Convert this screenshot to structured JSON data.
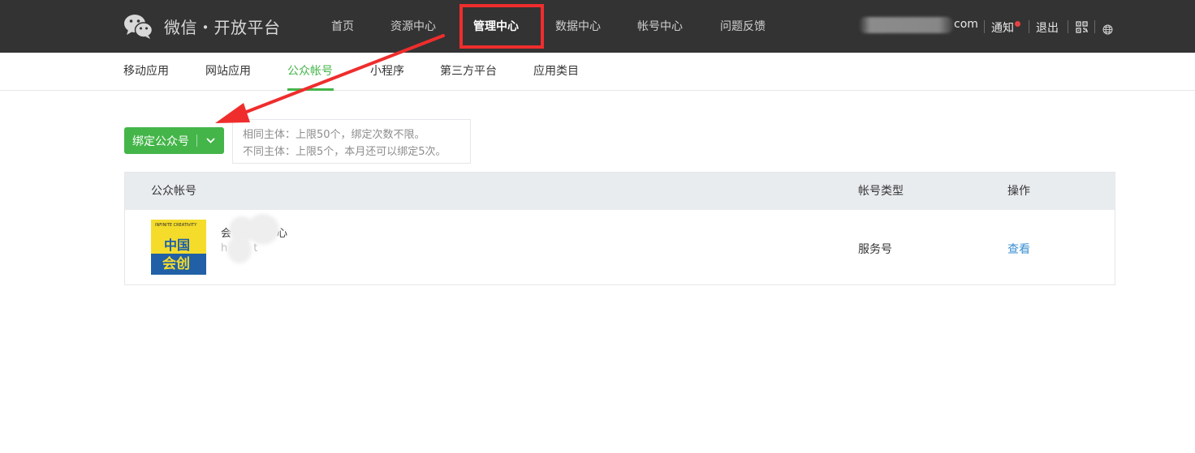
{
  "header": {
    "logo_icon": "wechat-logo-icon",
    "title": "微信・开放平台",
    "nav": [
      {
        "label": "首页"
      },
      {
        "label": "资源中心"
      },
      {
        "label": "管理中心"
      },
      {
        "label": "数据中心"
      },
      {
        "label": "帐号中心"
      },
      {
        "label": "问题反馈"
      }
    ],
    "account_suffix": "com",
    "notice": "通知",
    "logout": "退出",
    "qr_icon": "qrcode-icon",
    "globe_icon": "globe-icon"
  },
  "subnav": [
    {
      "label": "移动应用"
    },
    {
      "label": "网站应用"
    },
    {
      "label": "公众帐号"
    },
    {
      "label": "小程序"
    },
    {
      "label": "第三方平台"
    },
    {
      "label": "应用类目"
    }
  ],
  "bind": {
    "label": "绑定公众号",
    "tip_line1": "相同主体：上限50个，绑定次数不限。",
    "tip_line2": "不同主体：上限5个，本月还可以绑定5次。"
  },
  "table": {
    "headers": [
      "公众帐号",
      "帐号类型",
      "操作"
    ],
    "rows": [
      {
        "thumb_small": "INFINITE CREATIVITY",
        "thumb_line1": "中国",
        "thumb_line2": "会创",
        "name_start": "会",
        "name_end": "心",
        "id_start": "h",
        "id_end": "t",
        "type": "服务号",
        "action": "查看"
      }
    ]
  },
  "colors": {
    "topbar": "#333333",
    "accent_green": "#44b549",
    "highlight_red": "#ef2d2d",
    "link_blue": "#3a8fd2"
  }
}
